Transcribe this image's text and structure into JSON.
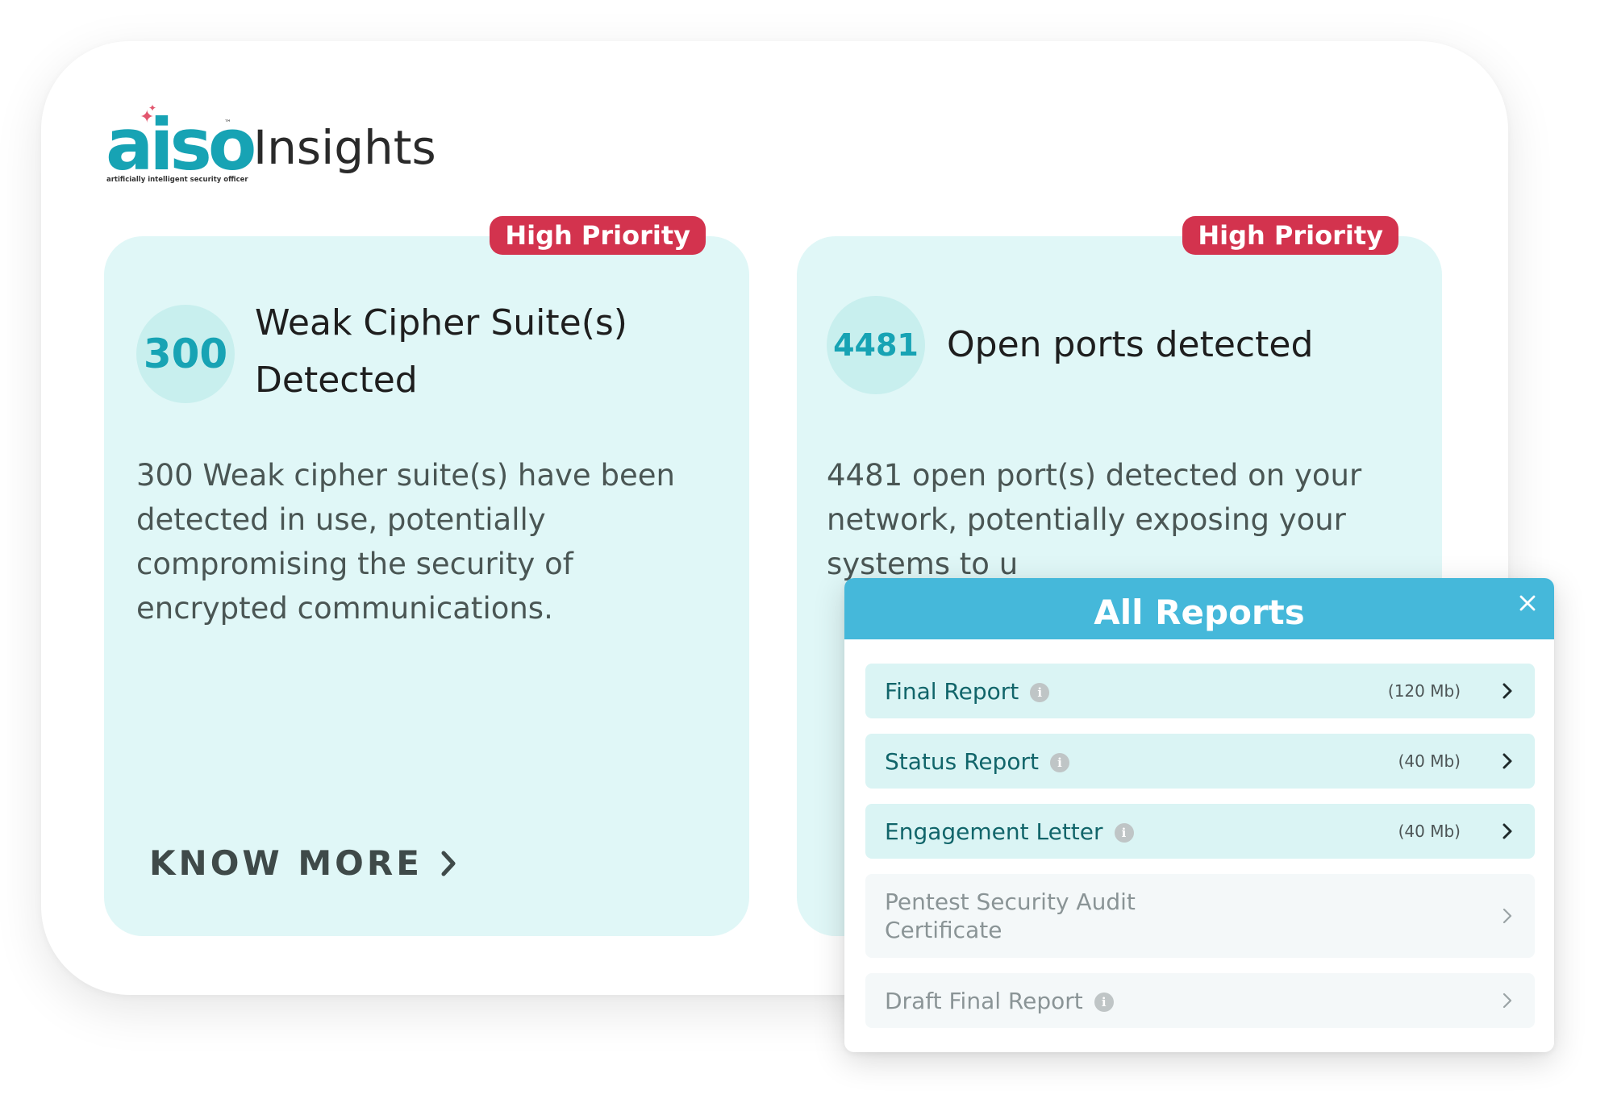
{
  "brand": {
    "logo_text": "aiso",
    "logo_tm": "™",
    "logo_tagline": "artificially intelligent security officer",
    "section_title": "Insights",
    "logo_color": "#17a3b4",
    "spark_color": "#e2566e"
  },
  "cards": [
    {
      "badge": "High Priority",
      "count": "300",
      "title": "Weak Cipher Suite(s) Detected",
      "description": "300 Weak cipher suite(s) have been detected in use, potentially compromising the security of encrypted communications.",
      "cta": "KNOW MORE"
    },
    {
      "badge": "High Priority",
      "count": "4481",
      "title": "Open ports detected",
      "description": "4481 open port(s) detected on your network, potentially exposing your systems to u"
    }
  ],
  "reports": {
    "title": "All Reports",
    "items": [
      {
        "label": "Final Report",
        "size": "(120 Mb)",
        "enabled": true
      },
      {
        "label": "Status Report",
        "size": "(40 Mb)",
        "enabled": true
      },
      {
        "label": "Engagement Letter",
        "size": "(40 Mb)",
        "enabled": true
      },
      {
        "label": "Pentest Security Audit Certificate",
        "size": "",
        "enabled": false
      },
      {
        "label": "Draft Final Report",
        "size": "",
        "enabled": false
      }
    ]
  },
  "colors": {
    "card_bg": "#e0f7f7",
    "badge_red": "#d3334e",
    "reports_header": "#45b8da",
    "row_active_text": "#11656a"
  },
  "icons": {
    "info": "info-icon",
    "chevron": "chevron-right-icon",
    "close": "close-icon",
    "sparkle": "sparkle-icon"
  }
}
